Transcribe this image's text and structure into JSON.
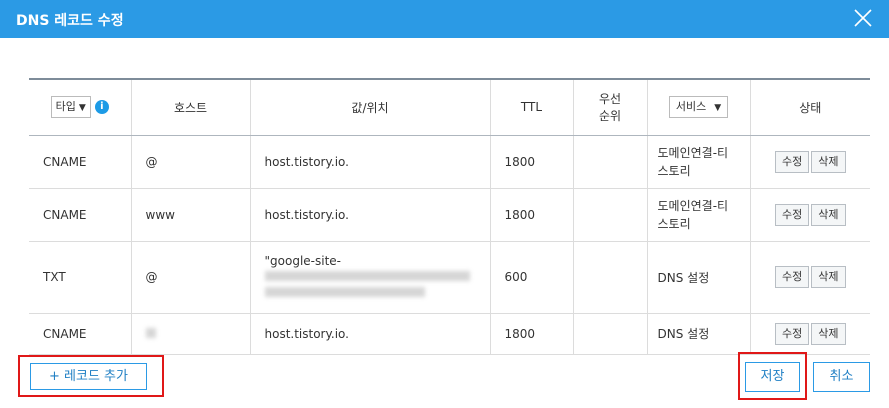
{
  "dialog": {
    "title": "DNS 레코드 수정"
  },
  "table": {
    "headers": {
      "type_select": "타입",
      "host": "호스트",
      "value": "값/위치",
      "ttl": "TTL",
      "priority_line1": "우선",
      "priority_line2": "순위",
      "service_select": "서비스",
      "status": "상태"
    },
    "rows": [
      {
        "type": "CNAME",
        "host": "@",
        "value": "host.tistory.io.",
        "ttl": "1800",
        "priority": "",
        "service_line1": "도메인연결-티",
        "service_line2": "스토리",
        "edit_label": "수정",
        "delete_label": "삭제"
      },
      {
        "type": "CNAME",
        "host": "www",
        "value": "host.tistory.io.",
        "ttl": "1800",
        "priority": "",
        "service_line1": "도메인연결-티",
        "service_line2": "스토리",
        "edit_label": "수정",
        "delete_label": "삭제"
      },
      {
        "type": "TXT",
        "host": "@",
        "value": "\"google-site-",
        "ttl": "600",
        "priority": "",
        "service_line1": "DNS 설정",
        "service_line2": "",
        "edit_label": "수정",
        "delete_label": "삭제"
      },
      {
        "type": "CNAME",
        "host": "",
        "value": "host.tistory.io.",
        "ttl": "1800",
        "priority": "",
        "service_line1": "DNS 설정",
        "service_line2": "",
        "edit_label": "수정",
        "delete_label": "삭제"
      }
    ]
  },
  "footer": {
    "add_record_label": "+ 레코드 추가",
    "save_label": "저장",
    "cancel_label": "취소"
  },
  "colors": {
    "titlebar": "#2b9ae5",
    "highlight": "#e01818",
    "accent_text": "#1f7fc4"
  }
}
